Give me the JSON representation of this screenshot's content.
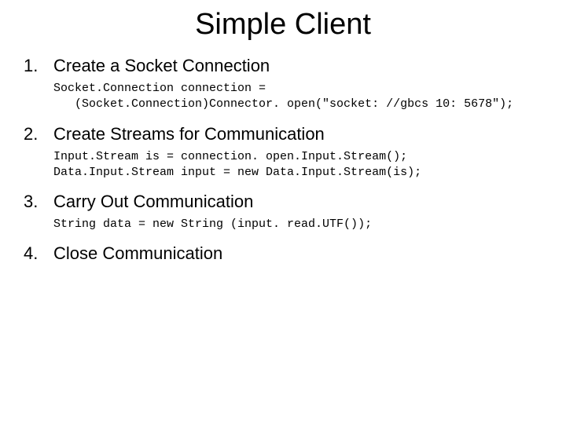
{
  "title": "Simple Client",
  "items": [
    {
      "num": "1.",
      "label": "Create a Socket Connection",
      "code": "Socket.Connection connection =\n   (Socket.Connection)Connector. open(\"socket: //gbcs 10: 5678\");"
    },
    {
      "num": "2.",
      "label": "Create Streams for Communication",
      "code": "Input.Stream is = connection. open.Input.Stream();\nData.Input.Stream input = new Data.Input.Stream(is);"
    },
    {
      "num": "3.",
      "label": "Carry Out Communication",
      "code": "String data = new String (input. read.UTF());"
    },
    {
      "num": "4.",
      "label": "Close Communication",
      "code": ""
    }
  ]
}
